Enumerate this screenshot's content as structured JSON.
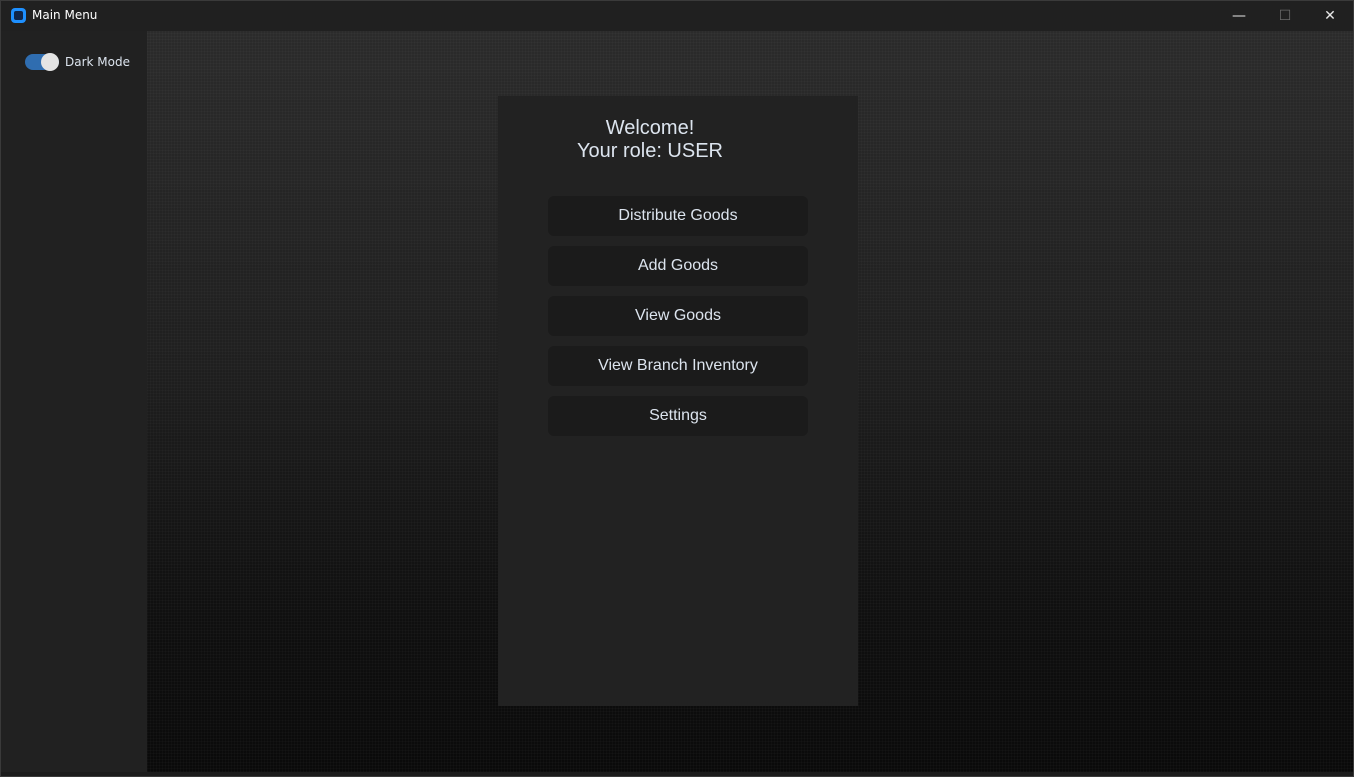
{
  "window": {
    "title": "Main Menu",
    "controls": {
      "minimize": "—",
      "maximize": "☐",
      "close": "✕"
    }
  },
  "sidebar": {
    "dark_mode_label": "Dark Mode",
    "dark_mode_on": true
  },
  "panel": {
    "welcome_line": "Welcome!",
    "role_line": "Your role: USER",
    "buttons": [
      "Distribute Goods",
      "Add Goods",
      "View Goods",
      "View Branch Inventory",
      "Settings"
    ]
  },
  "colors": {
    "accent": "#2f6db0",
    "app_icon": "#1e90ff",
    "panel": "#222222",
    "button": "#1b1b1b"
  }
}
